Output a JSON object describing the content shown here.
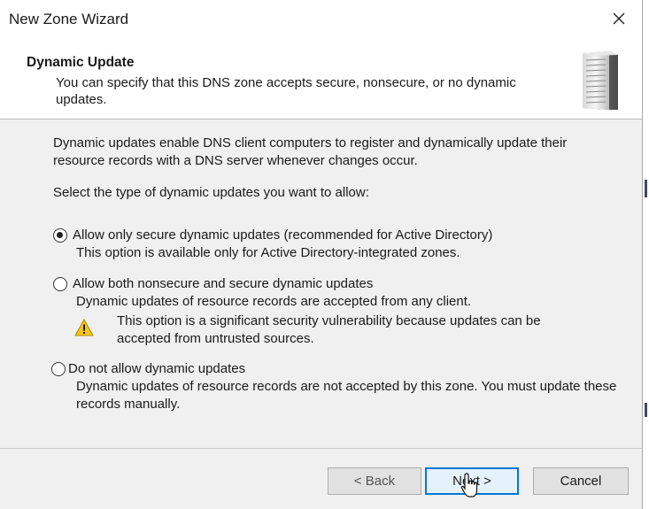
{
  "window": {
    "title": "New Zone Wizard",
    "close_glyph": "✕"
  },
  "header": {
    "title": "Dynamic Update",
    "description": "You can specify that this DNS zone accepts secure, nonsecure, or no dynamic updates.",
    "icon": "server-icon"
  },
  "content": {
    "intro": "Dynamic updates enable DNS client computers to register and dynamically update their resource records with a DNS server whenever changes occur.",
    "prompt": "Select the type of dynamic updates you want to allow:",
    "selected_option": "secure-only",
    "options": [
      {
        "id": "secure-only",
        "label": "Allow only secure dynamic updates (recommended for Active Directory)",
        "description": "This option is available only for Active Directory-integrated zones.",
        "checked": true
      },
      {
        "id": "nonsecure-and-secure",
        "label": "Allow both nonsecure and secure dynamic updates",
        "description": "Dynamic updates of resource records are accepted from any client.",
        "warning": "This option is a significant security vulnerability because updates can be accepted from untrusted sources.",
        "warning_icon": "warning-icon",
        "checked": false
      },
      {
        "id": "none",
        "label": "Do not allow dynamic updates",
        "description": "Dynamic updates of resource records are not accepted by this zone. You must update these records manually.",
        "checked": false
      }
    ]
  },
  "footer": {
    "back_label": "< Back",
    "next_label": "Next >",
    "cancel_label": "Cancel"
  },
  "colors": {
    "focus_border": "#0078d7",
    "warning_yellow": "#f5c518",
    "window_bg": "#f0f0f0"
  }
}
